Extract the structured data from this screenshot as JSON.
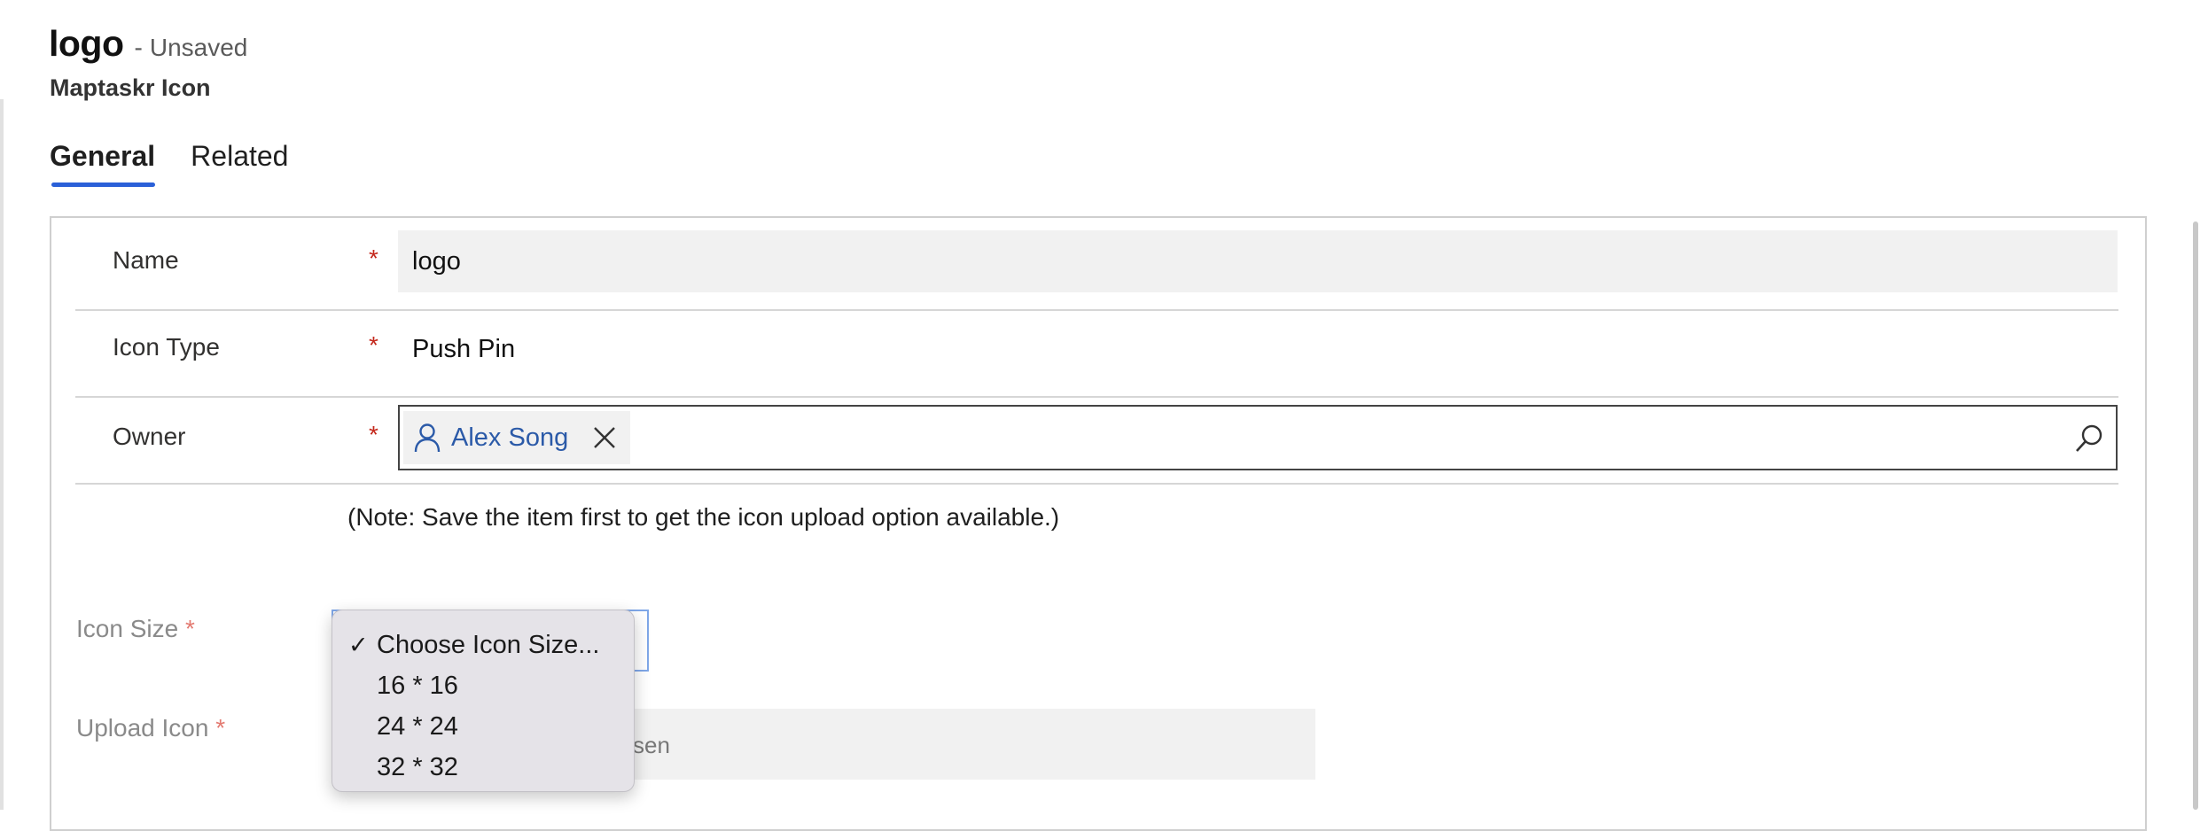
{
  "header": {
    "record_title": "logo",
    "separator": "-",
    "status": "Unsaved",
    "entity": "Maptaskr Icon"
  },
  "tabs": [
    {
      "label": "General",
      "active": true
    },
    {
      "label": "Related",
      "active": false
    }
  ],
  "form": {
    "required_marker": "*",
    "name": {
      "label": "Name",
      "value": "logo"
    },
    "icon_type": {
      "label": "Icon Type",
      "value": "Push Pin"
    },
    "owner": {
      "label": "Owner",
      "value": "Alex Song"
    },
    "note": "(Note: Save the item first to get the icon upload option available.)",
    "icon_size": {
      "label": "Icon Size",
      "selected": "Choose Icon Size...",
      "options": [
        "Choose Icon Size...",
        "16 * 16",
        "24 * 24",
        "32 * 32"
      ]
    },
    "upload_icon": {
      "label": "Upload Icon",
      "status_fragment": "sen"
    }
  },
  "colors": {
    "accent": "#2a60d8",
    "required": "#c4281c",
    "link": "#2b5aa8"
  },
  "icons": [
    "person-icon",
    "close-icon",
    "search-icon",
    "checkmark-icon"
  ]
}
